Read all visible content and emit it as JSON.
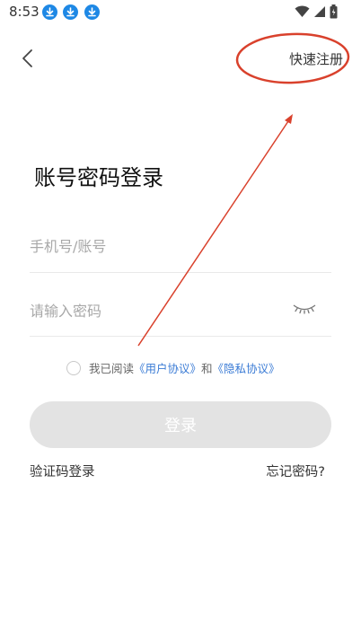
{
  "status_bar": {
    "time": "8:53",
    "download_icons": [
      "download-icon",
      "download-icon",
      "download-icon"
    ]
  },
  "header": {
    "back_icon": "chevron-left-icon",
    "register_label": "快速注册"
  },
  "form": {
    "title": "账号密码登录",
    "phone_placeholder": "手机号/账号",
    "password_placeholder": "请输入密码",
    "eye_icon": "eye-closed-icon"
  },
  "agreement": {
    "prefix": "我已阅读",
    "user_agreement": "《用户协议》",
    "conjunction": "和",
    "privacy_agreement": "《隐私协议》"
  },
  "actions": {
    "login_label": "登录",
    "sms_login_label": "验证码登录",
    "forgot_label": "忘记密码?"
  },
  "colors": {
    "link": "#3a7bd5",
    "button_disabled": "#e3e3e3",
    "annotation": "#d9412c",
    "status_icon_blue": "#1e88e5"
  }
}
